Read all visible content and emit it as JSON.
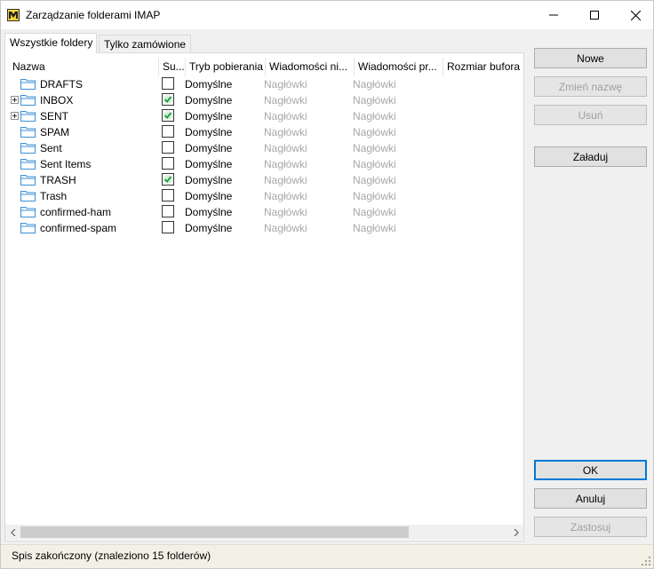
{
  "window": {
    "title": "Zarządzanie folderami IMAP",
    "controls": {
      "minimize": "minimize-icon",
      "maximize": "maximize-icon",
      "close": "close-icon"
    }
  },
  "tabs": [
    {
      "label": "Wszystkie foldery",
      "active": true
    },
    {
      "label": "Tylko zamówione",
      "active": false
    }
  ],
  "table": {
    "columns": [
      "Nazwa",
      "Su...",
      "Tryb pobierania",
      "Wiadomości ni...",
      "Wiadomości pr...",
      "Rozmiar bufora"
    ],
    "rows": [
      {
        "name": "DRAFTS",
        "expandable": false,
        "subscribed": false,
        "mode": "Domyślne",
        "col4": "Nagłówki",
        "col5": "Nagłówki"
      },
      {
        "name": "INBOX",
        "expandable": true,
        "subscribed": true,
        "mode": "Domyślne",
        "col4": "Nagłówki",
        "col5": "Nagłówki"
      },
      {
        "name": "SENT",
        "expandable": true,
        "subscribed": true,
        "mode": "Domyślne",
        "col4": "Nagłówki",
        "col5": "Nagłówki"
      },
      {
        "name": "SPAM",
        "expandable": false,
        "subscribed": false,
        "mode": "Domyślne",
        "col4": "Nagłówki",
        "col5": "Nagłówki"
      },
      {
        "name": "Sent",
        "expandable": false,
        "subscribed": false,
        "mode": "Domyślne",
        "col4": "Nagłówki",
        "col5": "Nagłówki"
      },
      {
        "name": "Sent Items",
        "expandable": false,
        "subscribed": false,
        "mode": "Domyślne",
        "col4": "Nagłówki",
        "col5": "Nagłówki"
      },
      {
        "name": "TRASH",
        "expandable": false,
        "subscribed": true,
        "mode": "Domyślne",
        "col4": "Nagłówki",
        "col5": "Nagłówki"
      },
      {
        "name": "Trash",
        "expandable": false,
        "subscribed": false,
        "mode": "Domyślne",
        "col4": "Nagłówki",
        "col5": "Nagłówki"
      },
      {
        "name": "confirmed-ham",
        "expandable": false,
        "subscribed": false,
        "mode": "Domyślne",
        "col4": "Nagłówki",
        "col5": "Nagłówki"
      },
      {
        "name": "confirmed-spam",
        "expandable": false,
        "subscribed": false,
        "mode": "Domyślne",
        "col4": "Nagłówki",
        "col5": "Nagłówki"
      }
    ]
  },
  "buttons": {
    "new": "Nowe",
    "rename": "Zmień nazwę",
    "delete": "Usuń",
    "load": "Załaduj",
    "ok": "OK",
    "cancel": "Anuluj",
    "apply": "Zastosuj"
  },
  "status": {
    "text": "Spis zakończony (znaleziono 15 folderów)"
  },
  "colors": {
    "accent": "#0078d7",
    "check": "#1e9e3a",
    "statusbar": "#f3f1e5",
    "folder": "#3d8fd6"
  }
}
